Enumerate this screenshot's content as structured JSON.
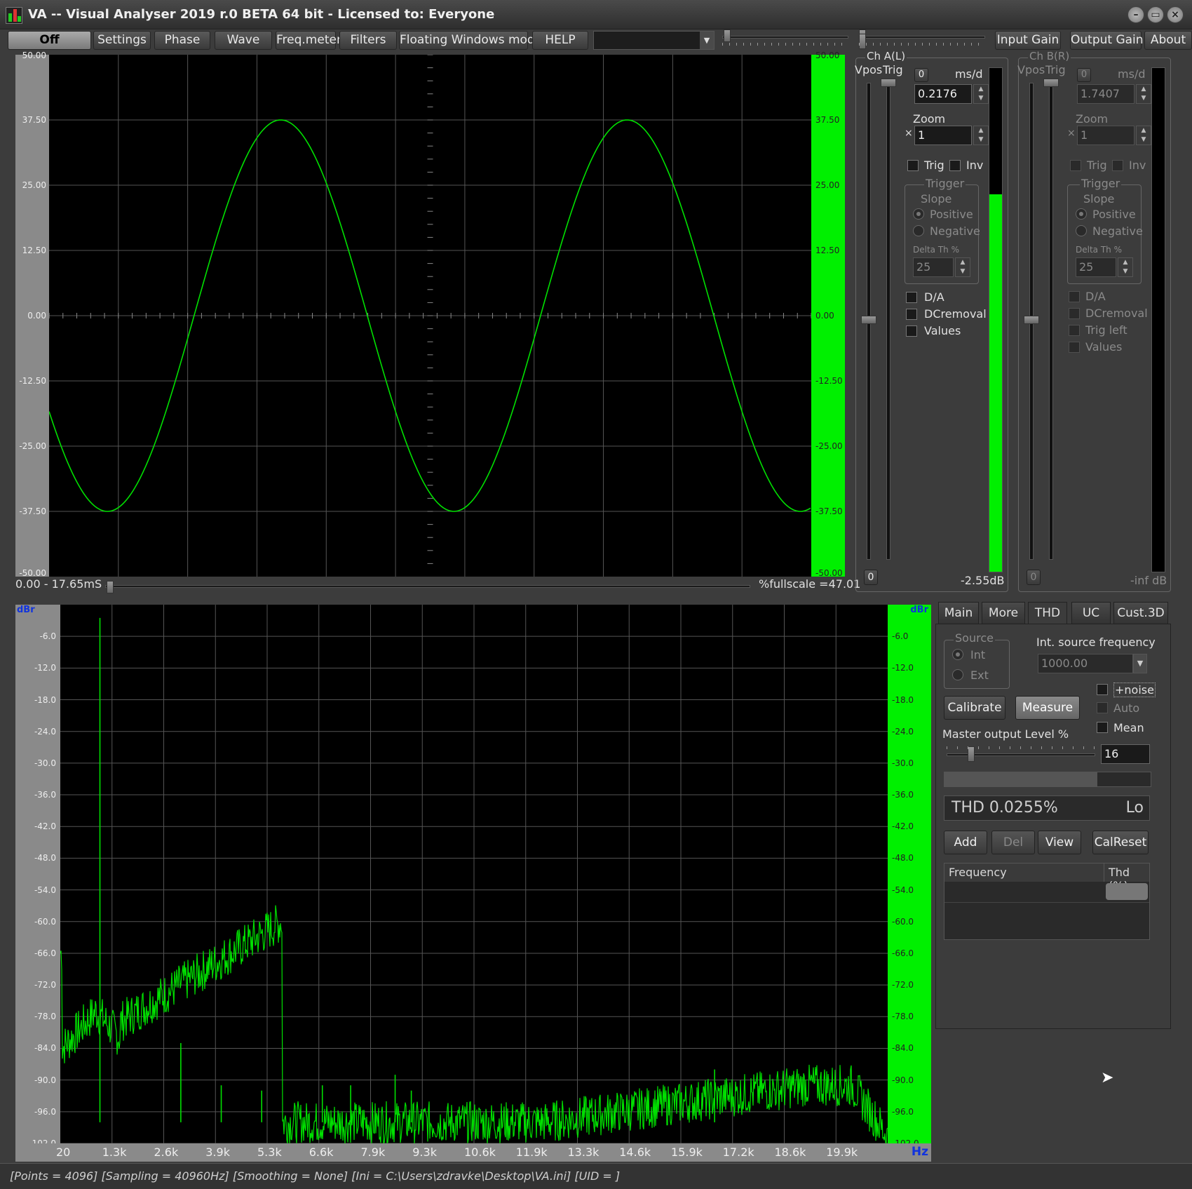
{
  "window": {
    "title": "VA -- Visual Analyser 2019 r.0 BETA 64 bit - Licensed to: Everyone",
    "minimize_label": "–",
    "maximize_label": "▭",
    "close_label": "×"
  },
  "toolbar": {
    "buttons": [
      "Off",
      "Settings",
      "Phase",
      "Wave",
      "Freq.meter",
      "Filters",
      "Floating Windows mode",
      "HELP"
    ],
    "right_buttons": [
      "Input Gain",
      "Output Gain",
      "About"
    ],
    "combo_value": "",
    "combo_arrow": "▼"
  },
  "scope": {
    "y_labels": [
      "37.50",
      "25.00",
      "12.50",
      "0.00",
      "-12.50",
      "-25.00",
      "-37.50"
    ],
    "y_label_top": "50.00",
    "y_label_bottom": "-50.00",
    "time_range": "0.00 - 17.65mS",
    "fullscale": "%fullscale =47.01"
  },
  "waveform": {
    "amplitude": 37.5,
    "y_range": [
      -50,
      50
    ],
    "cycles": 2.2,
    "color": "#00e000"
  },
  "chA": {
    "title": "Ch A(L)",
    "vpos": "Vpos",
    "trig": "Trig",
    "zero_btn": "0",
    "ms_d": "ms/d",
    "ms_value": "0.2176",
    "zoom_label": "Zoom",
    "zoom_x": "×",
    "zoom_value": "1",
    "trig_cb": "Trig",
    "inv_cb": "Inv",
    "trigger_group": "Trigger",
    "slope": "Slope",
    "positive": "Positive",
    "negative": "Negative",
    "delta_th": "Delta Th %",
    "delta_value": "25",
    "da": "D/A",
    "dcremoval": "DCremoval",
    "values": "Values",
    "bottom_zero": "0",
    "level_db": "-2.55dB",
    "level_fraction": 0.75
  },
  "chB": {
    "title": "Ch B(R)",
    "vpos": "Vpos",
    "trig": "Trig",
    "zero_btn": "0",
    "ms_d": "ms/d",
    "ms_value": "1.7407",
    "zoom_label": "Zoom",
    "zoom_x": "×",
    "zoom_value": "1",
    "trig_cb": "Trig",
    "inv_cb": "Inv",
    "trigger_group": "Trigger",
    "slope": "Slope",
    "positive": "Positive",
    "negative": "Negative",
    "delta_th": "Delta Th %",
    "delta_value": "25",
    "da": "D/A",
    "dcremoval": "DCremoval",
    "trig_left": "Trig left",
    "values": "Values",
    "bottom_zero": "0",
    "level_db": "-inf dB"
  },
  "spectrum": {
    "unit_left": "dBr",
    "unit_right": "dBr",
    "hz": "Hz",
    "y_labels": [
      "-6.0",
      "-12.0",
      "-18.0",
      "-24.0",
      "-30.0",
      "-36.0",
      "-42.0",
      "-48.0",
      "-54.0",
      "-60.0",
      "-66.0",
      "-72.0",
      "-78.0",
      "-84.0",
      "-90.0",
      "-96.0",
      "-102.0"
    ],
    "x_labels": [
      "20",
      "1.3k",
      "2.6k",
      "3.9k",
      "5.3k",
      "6.6k",
      "7.9k",
      "9.3k",
      "10.6k",
      "11.9k",
      "13.3k",
      "14.6k",
      "15.9k",
      "17.2k",
      "18.6k",
      "19.9k"
    ]
  },
  "spectrum_data": {
    "y_range": [
      -102,
      0
    ],
    "x_range": [
      20,
      20480
    ],
    "peak": {
      "freq": 1000,
      "db": -2.5
    },
    "noise_floor_db": -98,
    "low_hump_db": -77,
    "high_hump_db": -91,
    "spikes": [
      {
        "freq": 1000,
        "db": -2.5
      },
      {
        "freq": 3000,
        "db": -83
      },
      {
        "freq": 4000,
        "db": -91
      },
      {
        "freq": 5000,
        "db": -92
      },
      {
        "freq": 6500,
        "db": -91
      },
      {
        "freq": 7200,
        "db": -91
      },
      {
        "freq": 8300,
        "db": -89
      },
      {
        "freq": 8700,
        "db": -92
      },
      {
        "freq": 16200,
        "db": -88
      }
    ]
  },
  "panel": {
    "tabs": [
      "Main",
      "More",
      "THD",
      "UC",
      "Cust.3D"
    ],
    "source_group": "Source",
    "int_label": "Int",
    "ext_label": "Ext",
    "int_freq_label": "Int. source frequency",
    "int_freq_value": "1000.00",
    "noise_cb": "+noise",
    "auto_cb": "Auto",
    "mean_cb": "Mean",
    "calibrate": "Calibrate",
    "measure": "Measure",
    "master_label": "Master output Level %",
    "master_value": "16",
    "thd_readout": "THD 0.0255%",
    "thd_range": "Lo",
    "add": "Add",
    "del": "Del",
    "view": "View",
    "calreset": "CalReset",
    "col_frequency": "Frequency",
    "col_thd": "Thd (%)"
  },
  "status": {
    "text": "[Points = 4096]  [Sampling = 40960Hz]  [Smoothing = None]  [Ini = C:\\Users\\zdravke\\Desktop\\VA.ini]  [UID = ]"
  }
}
